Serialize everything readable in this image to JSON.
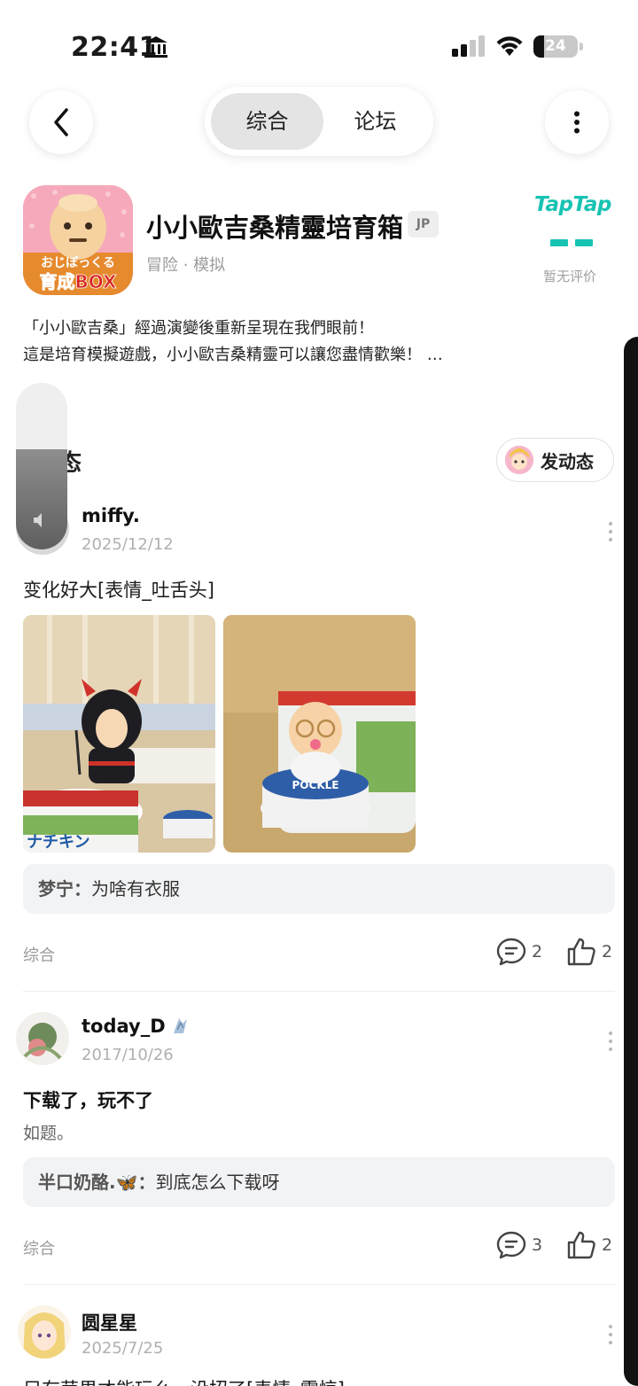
{
  "status_bar": {
    "time": "22:41",
    "battery": "24",
    "battery_level": 0.24,
    "icons": [
      "bank-icon",
      "signal-icon",
      "wifi-icon",
      "battery-icon"
    ]
  },
  "nav": {
    "tabs": [
      {
        "label": "综合",
        "active": true
      },
      {
        "label": "论坛",
        "active": false
      }
    ]
  },
  "app": {
    "title": "小小歐吉桑精靈培育箱",
    "region": "JP",
    "tags": "冒险 · 模拟",
    "rating_brand": "TapTap",
    "rating_text": "暂无评价",
    "icon_text": "育成BOX",
    "description_lines": [
      "「小小歐吉桑」經過演變後重新呈現在我們眼前！",
      "這是培育模擬遊戲，小小歐吉桑精靈可以讓您盡情歡樂！ …"
    ]
  },
  "overlay": {
    "volume_level": 0.6,
    "section_fragment": "态"
  },
  "post_button": {
    "label": "发动态"
  },
  "posts": [
    {
      "username": "miffy.",
      "date": "2025/12/12",
      "text": "变化好大[表情_吐舌头]",
      "comment_user": "梦宁",
      "comment_sep": "：",
      "comment_text": "为啥有衣服",
      "category": "综合",
      "comments": "2",
      "likes": "2"
    },
    {
      "username": "today_D",
      "date": "2017/10/26",
      "title": "下载了，玩不了",
      "text": "如题。",
      "comment_user": "半口奶酪.🦋",
      "comment_sep": "：",
      "comment_text": "到底怎么下载呀",
      "category": "综合",
      "comments": "3",
      "likes": "2"
    },
    {
      "username": "圆星星",
      "date": "2025/7/25",
      "text": "只有苹果才能玩么，没招了[表情_震惊]"
    }
  ]
}
